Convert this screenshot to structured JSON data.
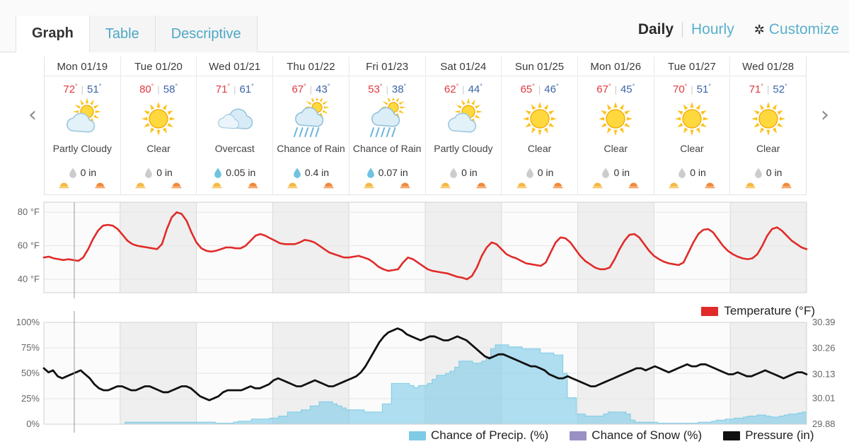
{
  "tabs": [
    {
      "label": "Graph",
      "active": true
    },
    {
      "label": "Table",
      "active": false
    },
    {
      "label": "Descriptive",
      "active": false
    }
  ],
  "topright": {
    "daily_label": "Daily",
    "hourly_label": "Hourly",
    "customize_label": "Customize",
    "gear_icon": "gear-icon"
  },
  "nav": {
    "prev": "‹",
    "next": "›"
  },
  "days": [
    {
      "name": "Mon 01/19",
      "high": "72",
      "low": "51",
      "condition": "Partly Cloudy",
      "icon": "partly-cloudy-icon",
      "precip": "0 in",
      "precip_wet": false
    },
    {
      "name": "Tue 01/20",
      "high": "80",
      "low": "58",
      "condition": "Clear",
      "icon": "sun-icon",
      "precip": "0 in",
      "precip_wet": false
    },
    {
      "name": "Wed 01/21",
      "high": "71",
      "low": "61",
      "condition": "Overcast",
      "icon": "cloud-icon",
      "precip": "0.05 in",
      "precip_wet": true
    },
    {
      "name": "Thu 01/22",
      "high": "67",
      "low": "43",
      "condition": "Chance of Rain",
      "icon": "rain-icon",
      "precip": "0.4 in",
      "precip_wet": true
    },
    {
      "name": "Fri 01/23",
      "high": "53",
      "low": "38",
      "condition": "Chance of Rain",
      "icon": "rain-icon",
      "precip": "0.07 in",
      "precip_wet": true
    },
    {
      "name": "Sat 01/24",
      "high": "62",
      "low": "44",
      "condition": "Partly Cloudy",
      "icon": "partly-cloudy-icon",
      "precip": "0 in",
      "precip_wet": false
    },
    {
      "name": "Sun 01/25",
      "high": "65",
      "low": "46",
      "condition": "Clear",
      "icon": "sun-icon",
      "precip": "0 in",
      "precip_wet": false
    },
    {
      "name": "Mon 01/26",
      "high": "67",
      "low": "45",
      "condition": "Clear",
      "icon": "sun-icon",
      "precip": "0 in",
      "precip_wet": false
    },
    {
      "name": "Tue 01/27",
      "high": "70",
      "low": "51",
      "condition": "Clear",
      "icon": "sun-icon",
      "precip": "0 in",
      "precip_wet": false
    },
    {
      "name": "Wed 01/28",
      "high": "71",
      "low": "52",
      "condition": "Clear",
      "icon": "sun-icon",
      "precip": "0 in",
      "precip_wet": false
    }
  ],
  "legends": {
    "temperature": "Temperature (°F)",
    "precip": "Chance of Precip. (%)",
    "snow": "Chance of Snow (%)",
    "pressure": "Pressure (in)"
  },
  "colors": {
    "temperature": "#e02b28",
    "precip": "#7ecbe6",
    "snow": "#9a90c4",
    "pressure": "#111111",
    "accent": "#58b0cc",
    "high": "#e0383e",
    "low": "#3c63a4"
  },
  "chart_data": [
    {
      "type": "line",
      "title": "Temperature",
      "ylabel": "°F",
      "ytick_labels": [
        "80 °F",
        "60 °F",
        "40 °F"
      ],
      "yticks": [
        80,
        60,
        40
      ],
      "ylim": [
        32,
        86
      ],
      "grid": true,
      "legend_position": "bottom-right",
      "series": [
        {
          "name": "Temperature (°F)",
          "color": "#e02b28",
          "unit": "°F",
          "values": [
            53,
            53.5,
            52.5,
            52,
            51.5,
            52,
            51.5,
            51,
            53,
            58,
            64,
            69,
            72,
            72.5,
            72,
            70,
            66.5,
            63,
            61,
            60,
            59.5,
            59,
            58.5,
            58,
            61,
            70,
            77,
            80,
            79,
            75,
            68,
            62,
            58.5,
            57,
            56.5,
            57,
            58,
            59,
            59,
            58.5,
            58.5,
            60,
            63,
            66,
            67,
            66,
            64.5,
            63,
            61.5,
            61,
            61,
            61,
            62,
            63.5,
            63,
            62,
            60,
            58,
            56,
            55,
            54,
            53,
            53,
            53.5,
            54,
            53,
            52,
            50,
            47.5,
            46,
            45,
            45.5,
            46,
            50,
            53,
            52,
            50,
            48,
            46,
            45,
            44.5,
            44,
            43.5,
            42.5,
            41.5,
            41,
            40,
            42,
            47,
            54,
            59,
            62,
            61,
            58,
            55,
            53.5,
            52.5,
            51,
            49.5,
            49,
            48.5,
            48,
            50,
            56,
            62,
            65,
            64.5,
            62,
            58,
            54,
            51,
            49,
            47,
            46,
            46,
            47,
            52,
            58,
            63,
            66.5,
            67,
            65,
            61,
            57,
            54,
            52,
            50.5,
            49.5,
            49,
            48.5,
            50,
            56,
            62,
            67,
            69.5,
            70,
            68,
            64,
            60,
            57,
            55,
            53.5,
            52.5,
            52,
            52.5,
            55,
            60,
            66,
            70,
            71,
            69,
            66,
            63,
            61,
            59,
            58
          ]
        }
      ]
    },
    {
      "type": "area+line",
      "title": "Chance of Precipitation / Snow / Pressure",
      "ylabel_left": "%",
      "ylabel_right": "in",
      "ytick_labels_left": [
        "100%",
        "75%",
        "50%",
        "25%",
        "0%"
      ],
      "yticks_left": [
        100,
        75,
        50,
        25,
        0
      ],
      "ylim_left": [
        0,
        100
      ],
      "ytick_labels_right": [
        "30.39",
        "30.26",
        "30.13",
        "30.01",
        "29.88"
      ],
      "yticks_right": [
        30.39,
        30.26,
        30.13,
        30.01,
        29.88
      ],
      "ylim_right": [
        29.88,
        30.39
      ],
      "grid": true,
      "legend_position": "bottom",
      "series": [
        {
          "name": "Chance of Precip. (%)",
          "color": "#7ecbe6",
          "axis": "left",
          "kind": "area",
          "values": [
            0,
            0,
            0,
            0,
            0,
            0,
            0,
            0,
            0,
            0,
            0,
            0,
            0,
            0,
            0,
            0,
            0,
            0,
            2,
            2,
            2,
            2,
            2,
            2,
            2,
            2,
            2,
            2,
            2,
            2,
            2,
            2,
            2,
            2,
            2,
            2,
            2,
            2,
            1,
            1,
            1,
            1,
            2,
            3,
            3,
            3,
            5,
            5,
            5,
            5,
            6,
            6,
            8,
            8,
            12,
            12,
            12,
            14,
            14,
            18,
            18,
            22,
            22,
            22,
            20,
            18,
            16,
            14,
            14,
            14,
            14,
            12,
            12,
            12,
            12,
            20,
            20,
            40,
            40,
            40,
            40,
            38,
            36,
            38,
            38,
            40,
            44,
            48,
            48,
            50,
            52,
            56,
            62,
            62,
            62,
            60,
            60,
            62,
            66,
            74,
            78,
            78,
            78,
            76,
            76,
            76,
            74,
            74,
            74,
            74,
            70,
            70,
            70,
            68,
            68,
            50,
            26,
            26,
            10,
            10,
            8,
            8,
            8,
            8,
            10,
            12,
            12,
            12,
            12,
            10,
            4,
            2,
            2,
            2,
            2,
            2,
            1,
            1,
            1,
            1,
            1,
            1,
            1,
            1,
            1,
            2,
            2,
            2,
            3,
            4,
            4,
            5,
            5,
            6,
            6,
            7,
            8,
            8,
            9,
            9,
            8,
            7,
            7,
            8,
            9,
            10,
            10,
            11,
            12
          ]
        },
        {
          "name": "Chance of Snow (%)",
          "color": "#9a90c4",
          "axis": "left",
          "kind": "area",
          "values": [
            0,
            0,
            0,
            0,
            0,
            0,
            0,
            0,
            0,
            0,
            0,
            0,
            0,
            0,
            0,
            0,
            0,
            0,
            0,
            0,
            0,
            0,
            0,
            0,
            0,
            0,
            0,
            0,
            0,
            0,
            0,
            0,
            0,
            0,
            0,
            0,
            0,
            0,
            0,
            0,
            0,
            0,
            0,
            0,
            0,
            0,
            0,
            0,
            0,
            0,
            0,
            0,
            0,
            0,
            0,
            0,
            0,
            0,
            0,
            0,
            0,
            0,
            0,
            0,
            0,
            0,
            0,
            0,
            0,
            0,
            0,
            0,
            0,
            0,
            0,
            0,
            0,
            0,
            0,
            0,
            0,
            0,
            0,
            0,
            0,
            0,
            0,
            0,
            0,
            0,
            0,
            0,
            0,
            0,
            0,
            0,
            0,
            0,
            0,
            0,
            0,
            0,
            0,
            0,
            0,
            0,
            0,
            0,
            0,
            0,
            0,
            0,
            0,
            0,
            0,
            0,
            0,
            0,
            0,
            0,
            0,
            0,
            0,
            0,
            0,
            0,
            0,
            0,
            0,
            0,
            0,
            0,
            0,
            0,
            0,
            0,
            0,
            0,
            0,
            0,
            0,
            0,
            0,
            0,
            0,
            0,
            0,
            0,
            0,
            0,
            0,
            0,
            0,
            0,
            0,
            0,
            0,
            0,
            0,
            0,
            0,
            0,
            0,
            0,
            0
          ]
        },
        {
          "name": "Pressure (in)",
          "color": "#111111",
          "axis": "right",
          "kind": "line",
          "values": [
            30.16,
            30.14,
            30.15,
            30.12,
            30.11,
            30.12,
            30.13,
            30.14,
            30.15,
            30.13,
            30.11,
            30.08,
            30.06,
            30.05,
            30.05,
            30.06,
            30.07,
            30.07,
            30.06,
            30.05,
            30.05,
            30.06,
            30.07,
            30.07,
            30.06,
            30.05,
            30.04,
            30.04,
            30.05,
            30.06,
            30.07,
            30.07,
            30.06,
            30.04,
            30.02,
            30.01,
            30.0,
            30.01,
            30.02,
            30.04,
            30.05,
            30.05,
            30.05,
            30.05,
            30.06,
            30.07,
            30.06,
            30.06,
            30.07,
            30.08,
            30.1,
            30.11,
            30.1,
            30.09,
            30.08,
            30.07,
            30.07,
            30.08,
            30.09,
            30.1,
            30.09,
            30.08,
            30.07,
            30.07,
            30.08,
            30.09,
            30.1,
            30.11,
            30.12,
            30.14,
            30.17,
            30.21,
            30.25,
            30.29,
            30.32,
            30.34,
            30.35,
            30.36,
            30.35,
            30.33,
            30.32,
            30.31,
            30.3,
            30.31,
            30.32,
            30.32,
            30.31,
            30.3,
            30.3,
            30.31,
            30.32,
            30.31,
            30.3,
            30.28,
            30.26,
            30.24,
            30.22,
            30.21,
            30.22,
            30.23,
            30.23,
            30.22,
            30.21,
            30.2,
            30.19,
            30.18,
            30.17,
            30.17,
            30.16,
            30.15,
            30.13,
            30.12,
            30.11,
            30.11,
            30.12,
            30.11,
            30.1,
            30.09,
            30.08,
            30.07,
            30.07,
            30.08,
            30.09,
            30.1,
            30.11,
            30.12,
            30.13,
            30.14,
            30.15,
            30.16,
            30.16,
            30.15,
            30.16,
            30.17,
            30.16,
            30.15,
            30.14,
            30.15,
            30.16,
            30.17,
            30.18,
            30.17,
            30.17,
            30.18,
            30.18,
            30.17,
            30.16,
            30.15,
            30.14,
            30.13,
            30.13,
            30.14,
            30.13,
            30.12,
            30.12,
            30.13,
            30.14,
            30.15,
            30.14,
            30.13,
            30.12,
            30.11,
            30.12,
            30.13,
            30.14,
            30.14,
            30.13
          ]
        }
      ]
    }
  ]
}
